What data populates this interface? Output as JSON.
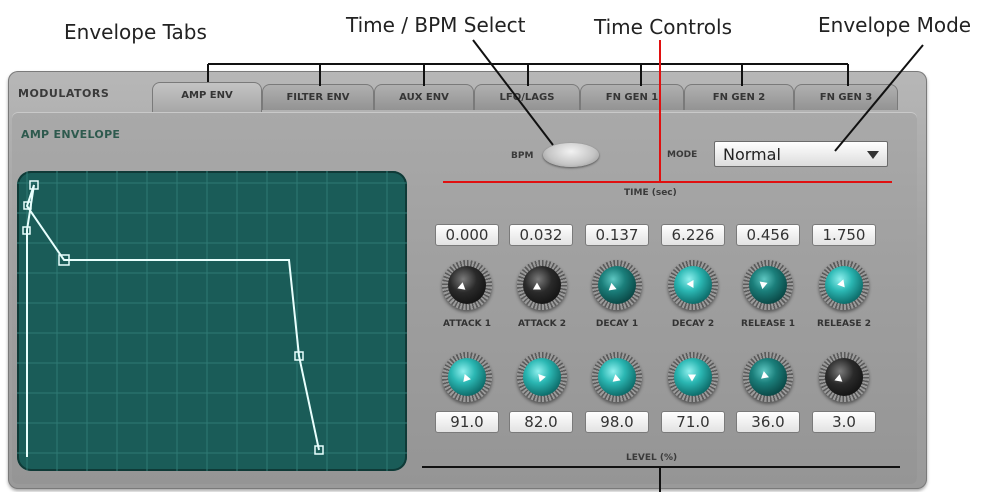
{
  "annotations": {
    "envelope_tabs": "Envelope Tabs",
    "time_bpm_select": "Time / BPM Select",
    "time_controls": "Time Controls",
    "envelope_mode": "Envelope Mode"
  },
  "panel_title": "MODULATORS",
  "tabs": [
    {
      "label": "AMP ENV",
      "active": true
    },
    {
      "label": "FILTER ENV",
      "active": false
    },
    {
      "label": "AUX ENV",
      "active": false
    },
    {
      "label": "LFO/LAGS",
      "active": false
    },
    {
      "label": "FN GEN 1",
      "active": false
    },
    {
      "label": "FN GEN 2",
      "active": false
    },
    {
      "label": "FN GEN 3",
      "active": false
    }
  ],
  "section_title": "AMP ENVELOPE",
  "bpm_label": "BPM",
  "mode_label": "MODE",
  "mode_value": "Normal",
  "time_header": "TIME (sec)",
  "level_header": "LEVEL (%)",
  "stages": [
    {
      "label": "ATTACK 1",
      "time": "0.000",
      "level": "91.0"
    },
    {
      "label": "ATTACK 2",
      "time": "0.032",
      "level": "82.0"
    },
    {
      "label": "DECAY 1",
      "time": "0.137",
      "level": "98.0"
    },
    {
      "label": "DECAY 2",
      "time": "6.226",
      "level": "71.0"
    },
    {
      "label": "RELEASE 1",
      "time": "0.456",
      "level": "36.0"
    },
    {
      "label": "RELEASE 2",
      "time": "1.750",
      "level": "3.0"
    }
  ],
  "colors": {
    "graph_bg": "#1a5c58",
    "grid": "#2f7a74",
    "envelope_line": "#e8fffd",
    "annotation_red": "#e01010"
  }
}
